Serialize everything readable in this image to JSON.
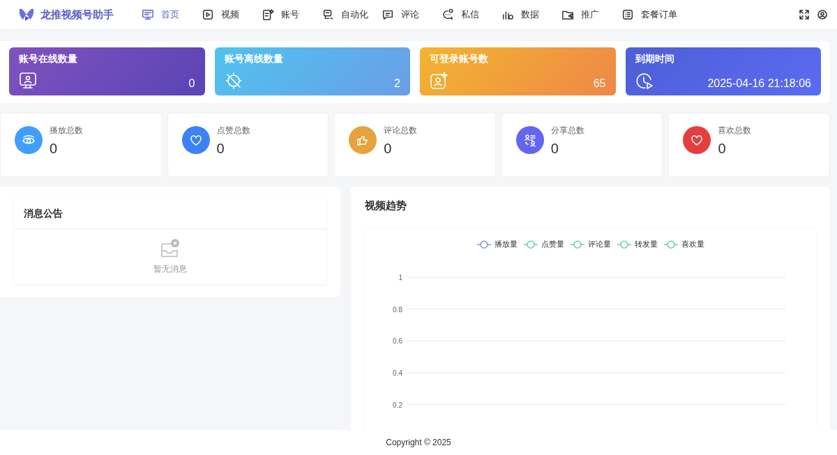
{
  "app": {
    "title": "龙推视频号助手"
  },
  "nav": [
    {
      "label": "首页",
      "kind": "home",
      "selected": true
    },
    {
      "label": "视频",
      "kind": "video",
      "selected": false
    },
    {
      "label": "账号",
      "kind": "account",
      "selected": false
    },
    {
      "label": "自动化",
      "kind": "auto",
      "selected": false
    },
    {
      "label": "评论",
      "kind": "comment",
      "selected": false
    },
    {
      "label": "私信",
      "kind": "message",
      "selected": false
    },
    {
      "label": "数据",
      "kind": "data",
      "selected": false
    },
    {
      "label": "推广",
      "kind": "promo",
      "selected": false
    },
    {
      "label": "套餐订单",
      "kind": "order",
      "selected": false
    }
  ],
  "banners": [
    {
      "kind": "online",
      "title": "账号在线数量",
      "value": "0"
    },
    {
      "kind": "offline",
      "title": "账号离线数量",
      "value": "2"
    },
    {
      "kind": "loginable",
      "title": "可登录账号数",
      "value": "65"
    },
    {
      "kind": "expiry",
      "title": "到期时间",
      "value": "2025-04-16 21:18:06"
    }
  ],
  "metrics": [
    {
      "kind": "play",
      "label": "播放总数",
      "value": "0",
      "color": "#409eff"
    },
    {
      "kind": "like",
      "label": "点赞总数",
      "value": "0",
      "color": "#3b82f6"
    },
    {
      "kind": "comment",
      "label": "评论总数",
      "value": "0",
      "color": "#e6a23c"
    },
    {
      "kind": "share",
      "label": "分享总数",
      "value": "0",
      "color": "#6366f1"
    },
    {
      "kind": "favorite",
      "label": "喜欢总数",
      "value": "0",
      "color": "#e53e3e"
    }
  ],
  "notice": {
    "title": "消息公告",
    "empty_text": "暂无消息"
  },
  "trend": {
    "title": "视频趋势",
    "chart_data": {
      "type": "line",
      "ylim": [
        0.2,
        1
      ],
      "grid": true,
      "yticks": [
        0.2,
        0.4,
        0.6,
        0.8,
        1
      ],
      "series": [
        {
          "name": "播放量",
          "color": "#8c8ff0"
        },
        {
          "name": "点赞量",
          "color": "#5fd3b8"
        },
        {
          "name": "评论量",
          "color": "#5fd3b8"
        },
        {
          "name": "转发量",
          "color": "#5fd3b8"
        },
        {
          "name": "喜欢量",
          "color": "#5fd3b8"
        }
      ]
    }
  },
  "footer": {
    "text": "Copyright © 2025"
  }
}
